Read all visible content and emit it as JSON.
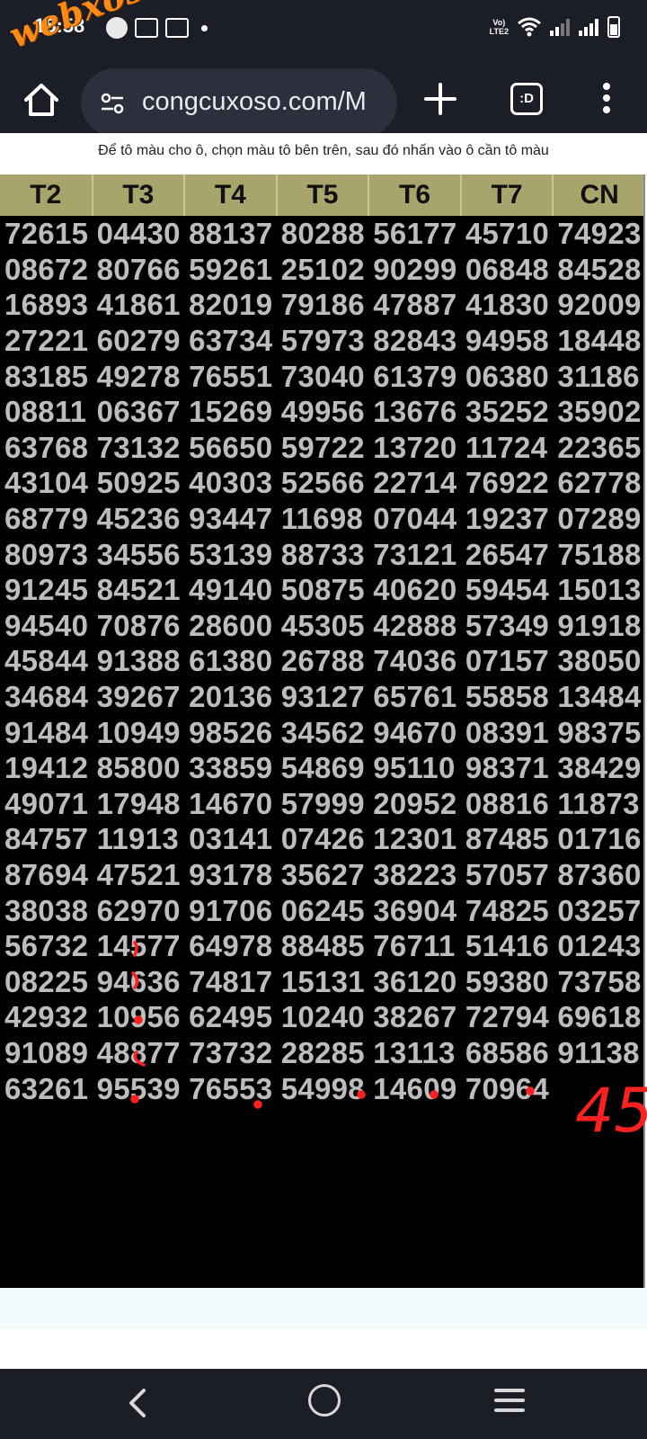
{
  "status_bar": {
    "time": "15:58",
    "network_label": "Vo)\nLTE2"
  },
  "watermark": "webxoso.net",
  "browser": {
    "url": "congcuxoso.com/M",
    "tabs_label": ":D"
  },
  "instruction": "Để tô màu cho ô, chọn màu tô bên trên, sau đó nhấn vào ô cần tô màu",
  "table": {
    "headers": [
      "T2",
      "T3",
      "T4",
      "T5",
      "T6",
      "T7",
      "CN"
    ],
    "rows": [
      [
        "72615",
        "04430",
        "88137",
        "80288",
        "56177",
        "45710",
        "74923"
      ],
      [
        "08672",
        "80766",
        "59261",
        "25102",
        "90299",
        "06848",
        "84528"
      ],
      [
        "16893",
        "41861",
        "82019",
        "79186",
        "47887",
        "41830",
        "92009"
      ],
      [
        "27221",
        "60279",
        "63734",
        "57973",
        "82843",
        "94958",
        "18448"
      ],
      [
        "83185",
        "49278",
        "76551",
        "73040",
        "61379",
        "06380",
        "31186"
      ],
      [
        "08811",
        "06367",
        "15269",
        "49956",
        "13676",
        "35252",
        "35902"
      ],
      [
        "63768",
        "73132",
        "56650",
        "59722",
        "13720",
        "11724",
        "22365"
      ],
      [
        "43104",
        "50925",
        "40303",
        "52566",
        "22714",
        "76922",
        "62778"
      ],
      [
        "68779",
        "45236",
        "93447",
        "11698",
        "07044",
        "19237",
        "07289"
      ],
      [
        "80973",
        "34556",
        "53139",
        "88733",
        "73121",
        "26547",
        "75188"
      ],
      [
        "91245",
        "84521",
        "49140",
        "50875",
        "40620",
        "59454",
        "15013"
      ],
      [
        "94540",
        "70876",
        "28600",
        "45305",
        "42888",
        "57349",
        "91918"
      ],
      [
        "45844",
        "91388",
        "61380",
        "26788",
        "74036",
        "07157",
        "38050"
      ],
      [
        "34684",
        "39267",
        "20136",
        "93127",
        "65761",
        "55858",
        "13484"
      ],
      [
        "91484",
        "10949",
        "98526",
        "34562",
        "94670",
        "08391",
        "98375"
      ],
      [
        "19412",
        "85800",
        "33859",
        "54869",
        "95110",
        "98371",
        "38429"
      ],
      [
        "49071",
        "17948",
        "14670",
        "57999",
        "20952",
        "08816",
        "11873"
      ],
      [
        "84757",
        "11913",
        "03141",
        "07426",
        "12301",
        "87485",
        "01716"
      ],
      [
        "87694",
        "47521",
        "93178",
        "35627",
        "38223",
        "57057",
        "87360"
      ],
      [
        "38038",
        "62970",
        "91706",
        "06245",
        "36904",
        "74825",
        "03257"
      ],
      [
        "56732",
        "14577",
        "64978",
        "88485",
        "76711",
        "51416",
        "01243"
      ],
      [
        "08225",
        "94636",
        "74817",
        "15131",
        "36120",
        "59380",
        "73758"
      ],
      [
        "42932",
        "10956",
        "62495",
        "10240",
        "38267",
        "72794",
        "69618"
      ],
      [
        "91089",
        "48877",
        "73732",
        "28285",
        "13113",
        "68586",
        "91138"
      ],
      [
        "63261",
        "95539",
        "76553",
        "54998",
        "14609",
        "70964",
        ""
      ]
    ]
  },
  "handwritten_note": "45",
  "colors": {
    "system_bar": "#1b1d27",
    "header_bg": "#a7a46c",
    "cell_bg": "#000000",
    "cell_text": "#bdbdbd",
    "annotation_red": "#ff2020",
    "watermark": "#ff8a14"
  }
}
